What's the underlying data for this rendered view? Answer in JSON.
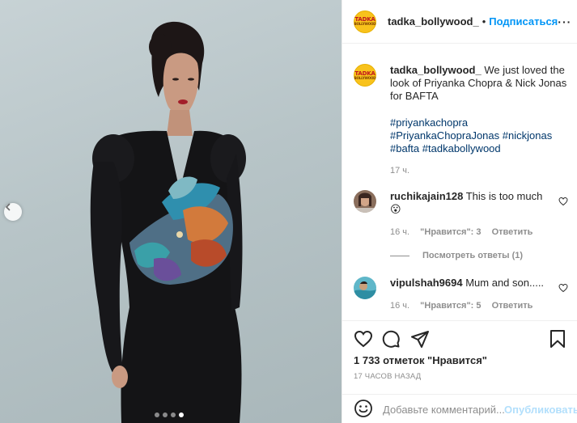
{
  "header": {
    "avatar_text": "TADKA",
    "avatar_subtext": "BOLLYWOOD",
    "username": "tadka_bollywood_",
    "bullet": "•",
    "follow_label": "Подписаться",
    "more_label": "···"
  },
  "caption": {
    "username": "tadka_bollywood_",
    "text": " We just loved the look of Priyanka Chopra & Nick Jonas for BAFTA",
    "hashtags": [
      "#priyankachopra",
      "#PriyankaChopraJonas",
      "#nickjonas",
      "#bafta",
      "#tadkabollywood"
    ],
    "time": "17 ч."
  },
  "comments": [
    {
      "username": "ruchikajain128",
      "text": " This is too much ",
      "emoji": "😮",
      "time": "16 ч.",
      "likes": "\"Нравится\": 3",
      "reply_label": "Ответить"
    },
    {
      "username": "vipulshah9694",
      "text": " Mum and son.....",
      "time": "16 ч.",
      "likes": "\"Нравится\": 5",
      "reply_label": "Ответить"
    }
  ],
  "view_replies_label": "Посмотреть ответы (1)",
  "actions": {
    "likes_text": "1 733 отметок \"Нравится\"",
    "posted_ago": "17 ЧАСОВ НАЗАД"
  },
  "add_comment": {
    "placeholder": "Добавьте комментарий...",
    "publish_label": "Опубликовать"
  },
  "carousel": {
    "total_slides": 4,
    "active_slide": 4
  },
  "colors": {
    "accent": "#0095f6",
    "hashtag": "#00376b",
    "muted": "#8e8e8e",
    "avatar_bg": "#f8c21c"
  }
}
